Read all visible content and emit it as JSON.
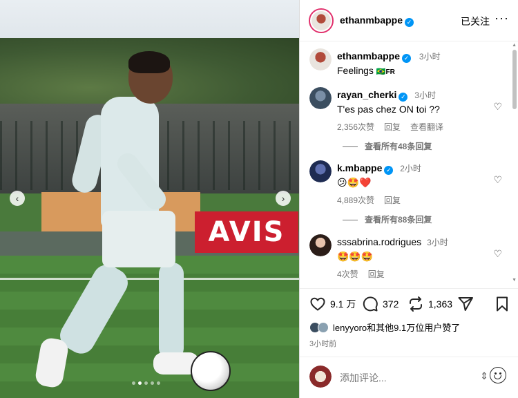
{
  "header": {
    "username": "ethanmbappe",
    "verified_mark": "✓",
    "follow_status": "已关注",
    "more_icon": "···"
  },
  "post": {
    "author": "ethanmbappe",
    "time": "3小时",
    "caption": "Feelings",
    "flag_text": "FR",
    "flag_emoji": "🇧🇷"
  },
  "comments": [
    {
      "user": "rayan_cherki",
      "verified": true,
      "time": "3小时",
      "text": "T'es pas chez ON toi ??",
      "likes": "2,356次赞",
      "reply_label": "回复",
      "translate_label": "查看翻译",
      "view_replies": "查看所有48条回复"
    },
    {
      "user": "k.mbappe",
      "verified": true,
      "time": "2小时",
      "text": "😕🤩❤️",
      "likes": "4,889次赞",
      "reply_label": "回复",
      "view_replies": "查看所有88条回复"
    },
    {
      "user": "sssabrina.rodrigues",
      "verified": false,
      "time": "3小时",
      "text": "🤩🤩🤩",
      "likes": "4次赞",
      "reply_label": "回复"
    }
  ],
  "actions": {
    "like_count": "9.1 万",
    "comment_count": "372",
    "repost_count": "1,363",
    "icons": [
      "heart-icon",
      "comment-icon",
      "repost-icon",
      "share-icon",
      "bookmark-icon"
    ]
  },
  "likes_summary": {
    "liker": "lenyyoro",
    "rest": "和其他9.1万位用户赞了"
  },
  "time_ago": "3小时前",
  "add_comment": {
    "placeholder": "添加评论..."
  },
  "image": {
    "billboard_text": "AVIS",
    "prev_label": "‹",
    "next_label": "›",
    "carousel_count": 5,
    "carousel_active": 2
  },
  "colors": {
    "verified_blue": "#0095f6",
    "avis_red": "#cc1f2f",
    "muted_text": "#737373"
  }
}
